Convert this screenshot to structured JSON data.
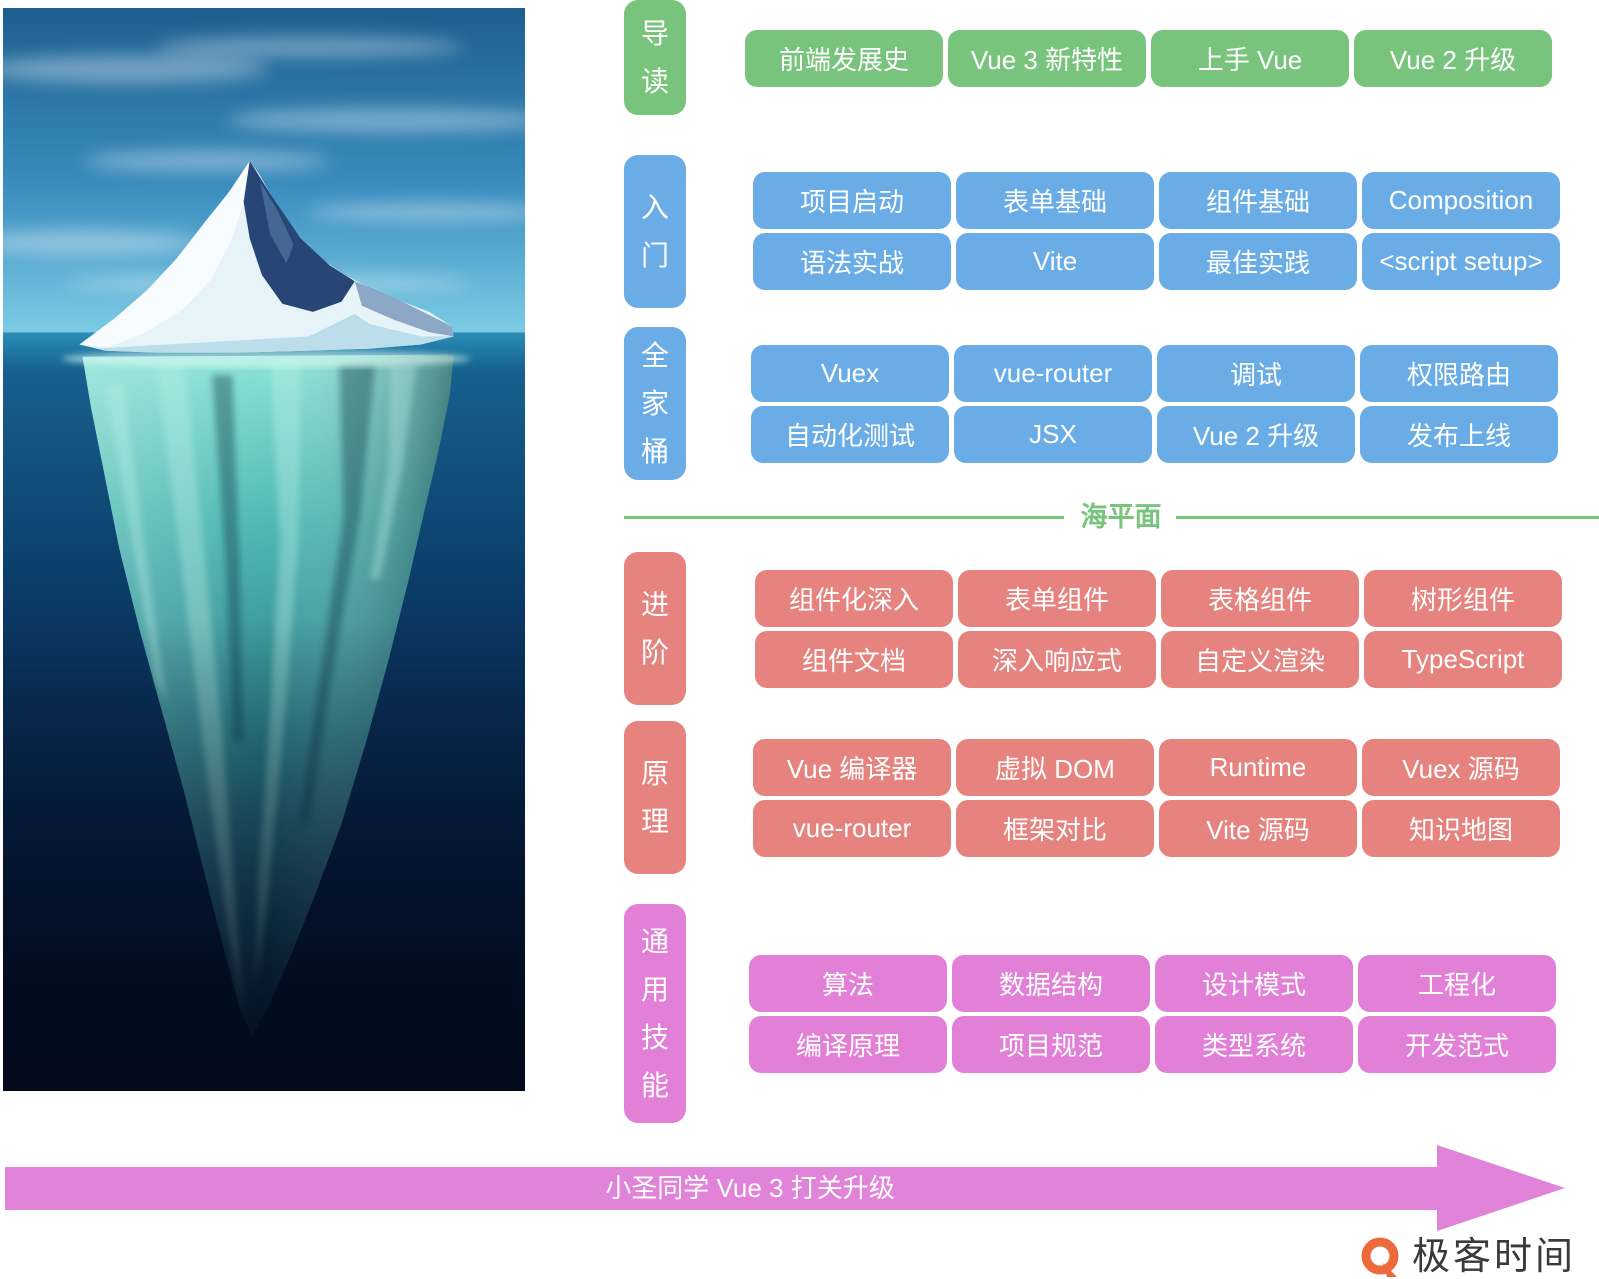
{
  "sections": [
    {
      "label": "导读",
      "color": "#79c47c",
      "items": [
        "前端发展史",
        "Vue 3 新特性",
        "上手 Vue",
        "Vue 2 升级"
      ]
    },
    {
      "label": "入门",
      "color": "#6aade6",
      "items": [
        "项目启动",
        "表单基础",
        "组件基础",
        "Composition",
        "语法实战",
        "Vite",
        "最佳实践",
        "<script setup>"
      ]
    },
    {
      "label": "全家桶",
      "color": "#6aade6",
      "items": [
        "Vuex",
        "vue-router",
        "调试",
        "权限路由",
        "自动化测试",
        "JSX",
        "Vue 2 升级",
        "发布上线"
      ]
    },
    {
      "label": "进阶",
      "color": "#e6837e",
      "items": [
        "组件化深入",
        "表单组件",
        "表格组件",
        "树形组件",
        "组件文档",
        "深入响应式",
        "自定义渲染",
        "TypeScript"
      ]
    },
    {
      "label": "原理",
      "color": "#e6837e",
      "items": [
        "Vue 编译器",
        "虚拟 DOM",
        "Runtime",
        "Vuex 源码",
        "vue-router",
        "框架对比",
        "Vite 源码",
        "知识地图"
      ]
    },
    {
      "label": "通用技能",
      "color": "#e180d6",
      "items": [
        "算法",
        "数据结构",
        "设计模式",
        "工程化",
        "编译原理",
        "项目规范",
        "类型系统",
        "开发范式"
      ]
    }
  ],
  "sea_level": {
    "label": "海平面",
    "color": "#79c47c"
  },
  "arrow": {
    "label": "小圣同学 Vue 3 打关升级",
    "color": "#e183d8"
  },
  "logo": {
    "text": "极客时间",
    "icon": "geektime-logo-icon",
    "color": "#ec6a3c"
  }
}
